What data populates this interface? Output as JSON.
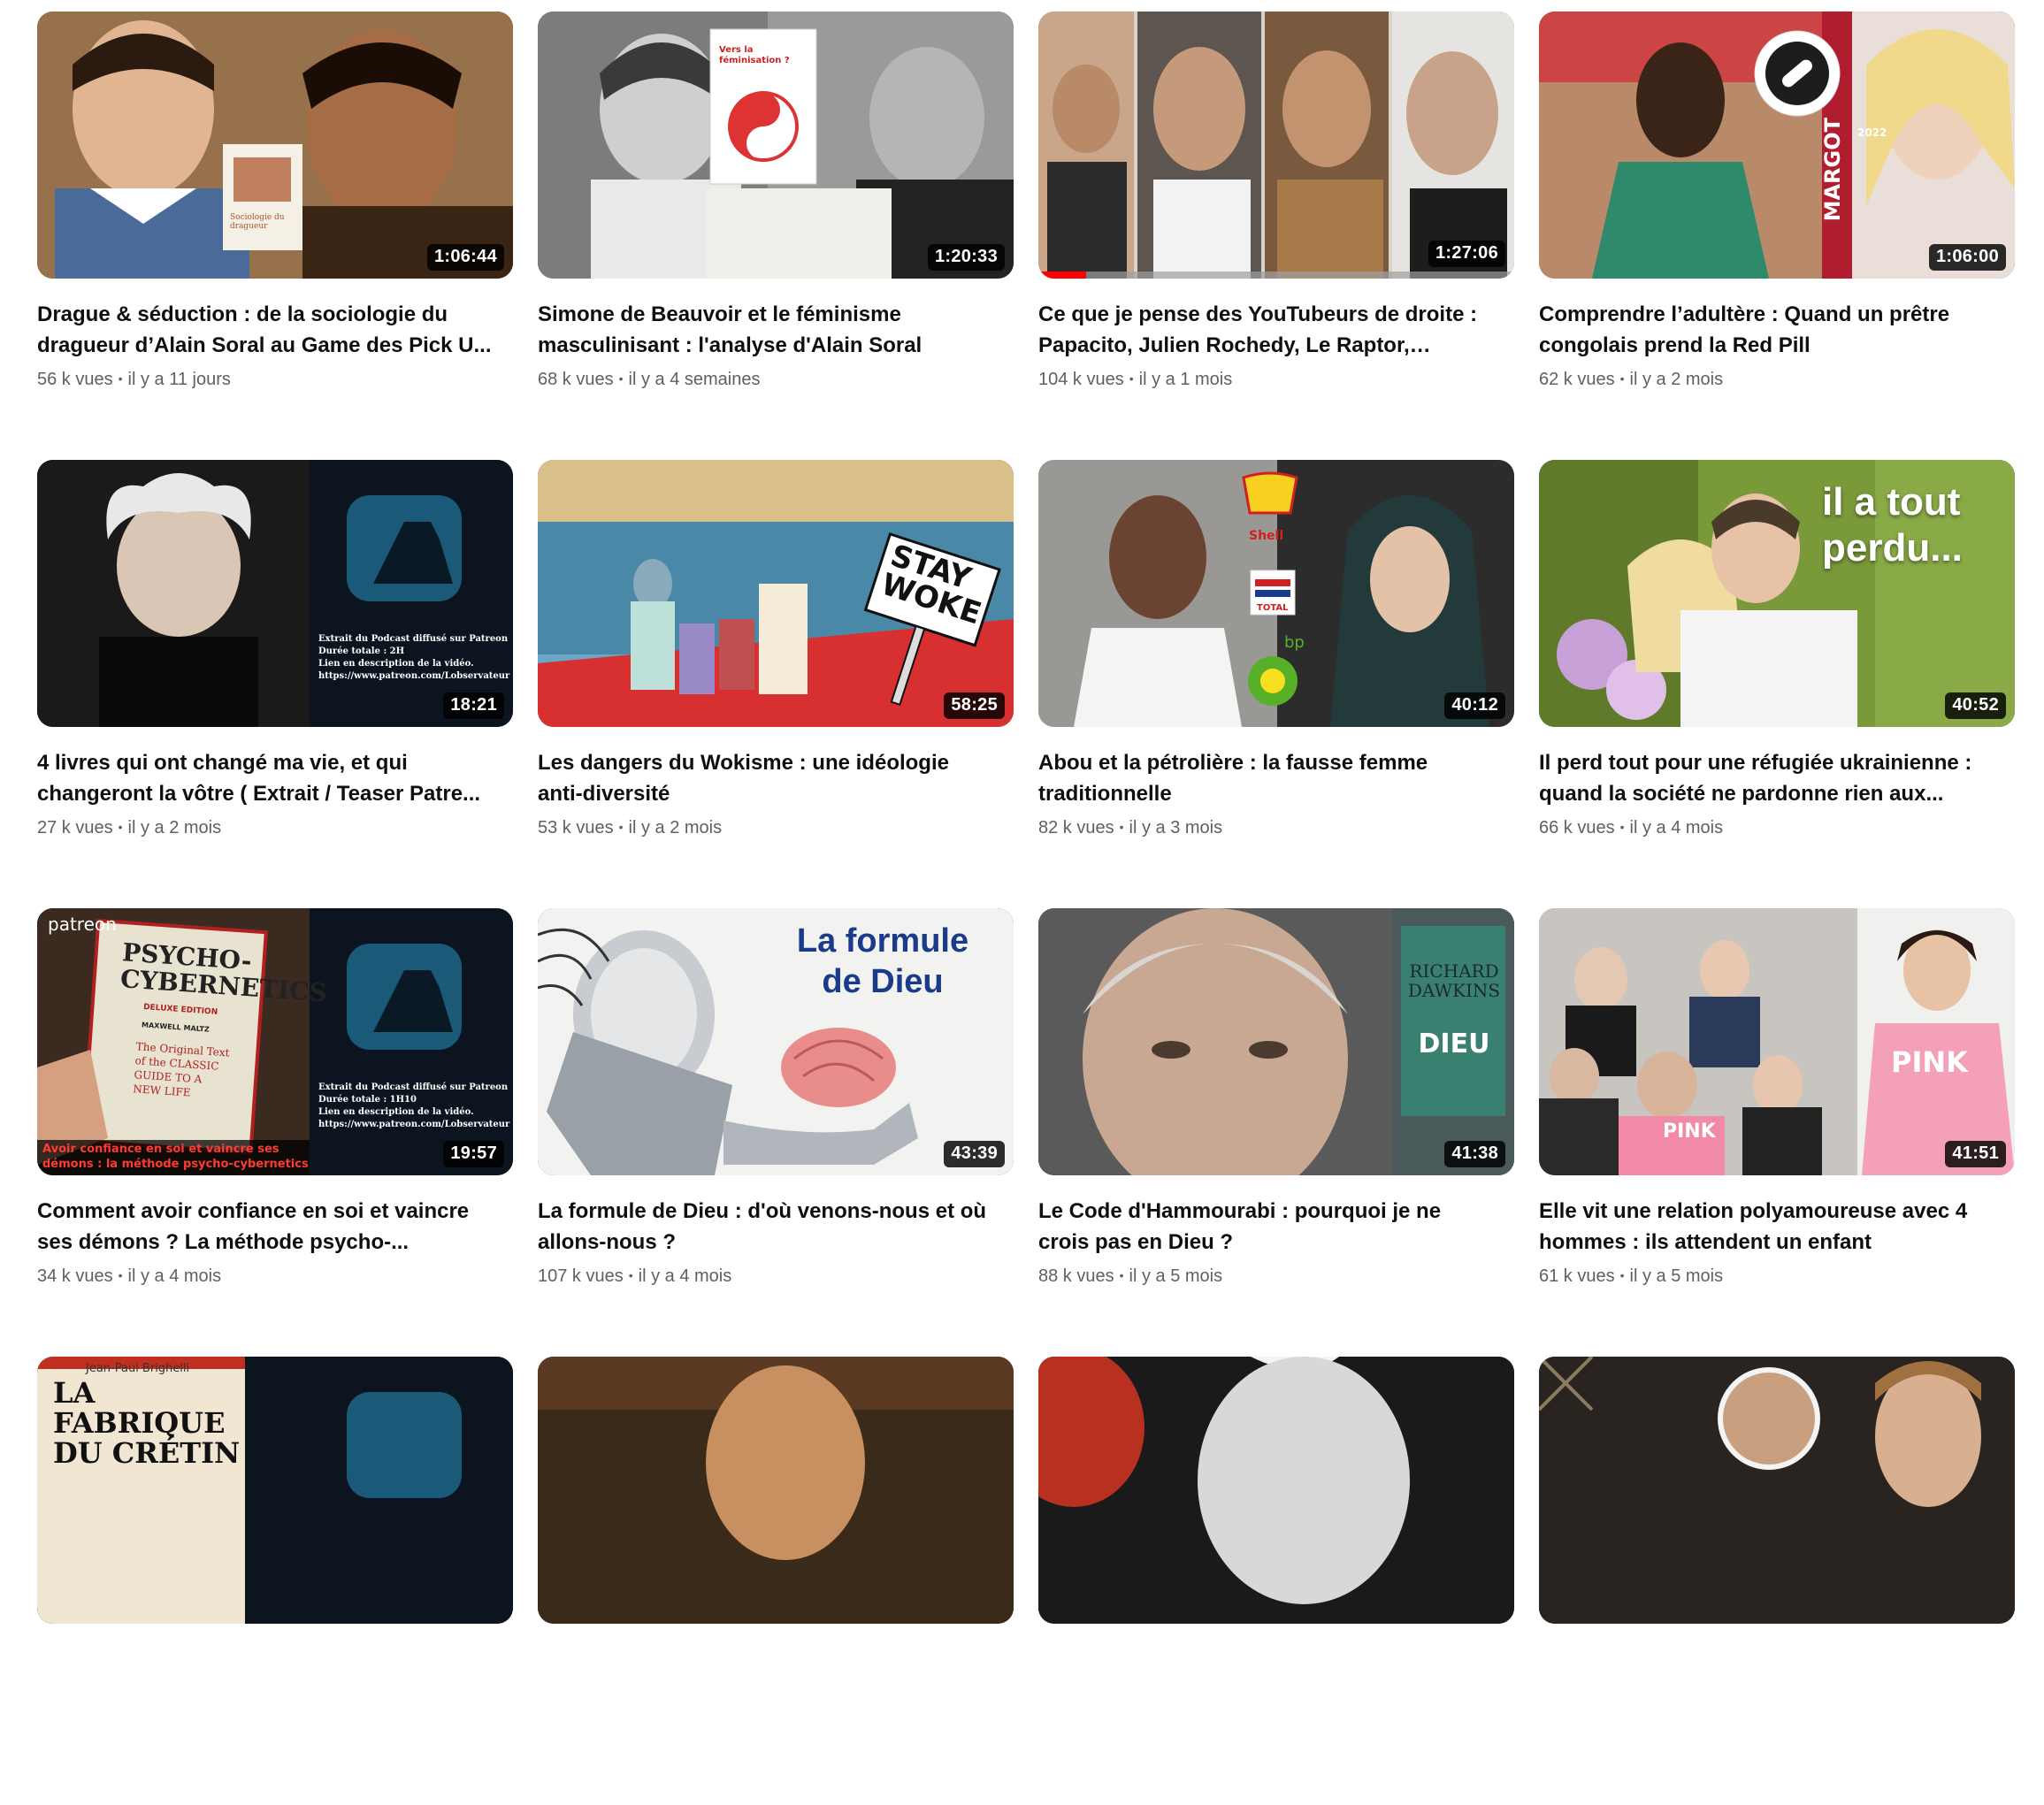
{
  "videos": [
    {
      "title": "Drague & séduction : de la sociologie du dragueur d’Alain Soral au Game des Pick U...",
      "views": "56 k vues",
      "age": "il y a 11 jours",
      "duration": "1:06:44",
      "progress": 0
    },
    {
      "title": "Simone de Beauvoir et le féminisme masculinisant : l'analyse d'Alain Soral",
      "views": "68 k vues",
      "age": "il y a 4 semaines",
      "duration": "1:20:33",
      "progress": 0
    },
    {
      "title": "Ce que je pense des YouTubeurs de droite : Papacito, Julien Rochedy, Le Raptor, Baptis...",
      "views": "104 k vues",
      "age": "il y a 1 mois",
      "duration": "1:27:06",
      "progress": 0.1
    },
    {
      "title": "Comprendre l’adultère : Quand un prêtre congolais prend la Red Pill",
      "views": "62 k vues",
      "age": "il y a 2 mois",
      "duration": "1:06:00",
      "progress": 0
    },
    {
      "title": "4 livres qui ont changé ma vie, et qui changeront la vôtre ( Extrait / Teaser Patre...",
      "views": "27 k vues",
      "age": "il y a 2 mois",
      "duration": "18:21",
      "progress": 0
    },
    {
      "title": "Les dangers du Wokisme : une idéologie anti-diversité",
      "views": "53 k vues",
      "age": "il y a 2 mois",
      "duration": "58:25",
      "progress": 0
    },
    {
      "title": "Abou et la pétrolière : la fausse femme traditionnelle",
      "views": "82 k vues",
      "age": "il y a 3 mois",
      "duration": "40:12",
      "progress": 0
    },
    {
      "title": "Il perd tout pour une réfugiée ukrainienne : quand la société ne pardonne rien aux...",
      "views": "66 k vues",
      "age": "il y a 4 mois",
      "duration": "40:52",
      "progress": 0
    },
    {
      "title": "Comment avoir confiance en soi et vaincre ses démons ? La méthode psycho-...",
      "views": "34 k vues",
      "age": "il y a 4 mois",
      "duration": "19:57",
      "progress": 0
    },
    {
      "title": "La formule de Dieu : d'où venons-nous et où allons-nous ?",
      "views": "107 k vues",
      "age": "il y a 4 mois",
      "duration": "43:39",
      "progress": 0
    },
    {
      "title": "Le Code d'Hammourabi : pourquoi je ne crois pas en Dieu ?",
      "views": "88 k vues",
      "age": "il y a 5 mois",
      "duration": "41:38",
      "progress": 0
    },
    {
      "title": "Elle vit une relation polyamoureuse avec 4 hommes : ils attendent un enfant",
      "views": "61 k vues",
      "age": "il y a 5 mois",
      "duration": "41:51",
      "progress": 0
    },
    {
      "title": "",
      "views": "",
      "age": "",
      "duration": "",
      "progress": 0
    },
    {
      "title": "",
      "views": "",
      "age": "",
      "duration": "",
      "progress": 0
    },
    {
      "title": "",
      "views": "",
      "age": "",
      "duration": "",
      "progress": 0
    },
    {
      "title": "",
      "views": "",
      "age": "",
      "duration": "",
      "progress": 0
    }
  ],
  "thumb_text": {
    "t1_book_title": "Sociologie du dragueur",
    "t2_book_title": "Vers la féminisation ?",
    "t4_brand": "MARGOT",
    "t4_year": "2022",
    "t5_caption_1": "Extrait du Podcast diffusé sur Patreon",
    "t5_caption_2": "Durée totale : 2H",
    "t5_caption_3": "Lien en description de la vidéo.",
    "t5_caption_4": "https://www.patreon.com/Lobservateur",
    "t6_sign": "STAY WOKE",
    "t7_brand_1": "Shell",
    "t7_brand_2": "TOTAL",
    "t7_brand_3": "bp",
    "t8_overlay": "il a tout perdu...",
    "t9_brand": "patreon",
    "t9_book": "PSYCHO-CYBERNETICS",
    "t9_book_sub": "DELUXE EDITION",
    "t9_book_author": "MAXWELL MALTZ",
    "t9_book_tag": "The Original Text of the CLASSIC GUIDE TO A NEW LIFE",
    "t9_caption_1": "Extrait du Podcast diffusé sur Patreon",
    "t9_caption_2": "Durée totale : 1H10",
    "t9_caption_3": "Lien en description de la vidéo.",
    "t9_caption_4": "https://www.patreon.com/Lobservateur",
    "t9_bottom_1": "Avoir confiance en soi et vaincre ses",
    "t9_bottom_2": "démons : la méthode psycho-cybernetics",
    "t10_overlay": "La formule de Dieu",
    "t11_book_author": "RICHARD DAWKINS",
    "t11_book_title": "DIEU",
    "t12_shirt_1": "PINK",
    "t12_shirt_2": "PINK",
    "t13_author": "Jean-Paul Brighelli",
    "t13_title": "LA FABRIQUE DU CRÉTIN"
  },
  "colors": {
    "title": "#0f0f0f",
    "meta": "#606060",
    "progress": "#ff0000"
  }
}
